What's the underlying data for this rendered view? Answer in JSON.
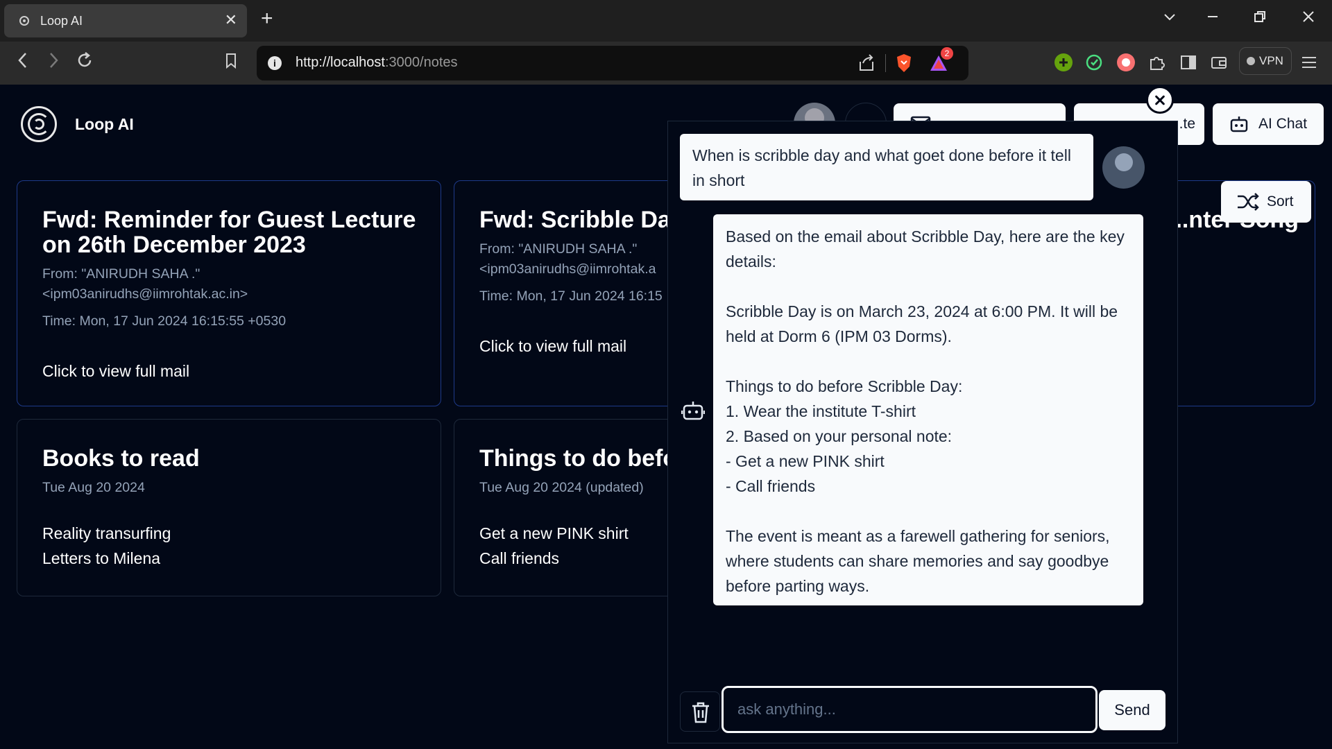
{
  "browser": {
    "tab_title": "Loop AI",
    "tab_close": "✕",
    "new_tab": "+",
    "url_host": "http://localhost",
    "url_path": ":3000/notes",
    "notification_count": "2",
    "vpn_label": "VPN"
  },
  "app": {
    "brand": "Loop AI",
    "header_buttons": [
      {
        "label": "...te"
      },
      {
        "label": "AI Chat"
      }
    ],
    "sort_label": "Sort"
  },
  "notes": [
    {
      "title": "Fwd: Reminder for Guest Lecture on 26th December 2023",
      "from_line1": "From: \"ANIRUDH SAHA .\"",
      "from_line2": "<ipm03anirudhs@iimrohtak.ac.in>",
      "time": "Time: Mon, 17 Jun 2024 16:15:55 +0530",
      "body": "Click to view full mail"
    },
    {
      "title": "Fwd: Scribble Day",
      "from_line1": "From: \"ANIRUDH SAHA .\"",
      "from_line2": "<ipm03anirudhs@iimrohtak.a",
      "time": "Time: Mon, 17 Jun 2024 16:15",
      "body": "Click to view full mail"
    },
    {
      "title": "...nter Song"
    },
    {
      "title": "Books to read",
      "date": "Tue Aug 20 2024",
      "lines": [
        "Reality transurfing",
        "Letters to Milena"
      ]
    },
    {
      "title": "Things to do befo",
      "date": "Tue Aug 20 2024 (updated)",
      "lines": [
        "Get a new PINK shirt",
        "Call friends"
      ]
    }
  ],
  "chat": {
    "user_message": "When is scribble day and what goet done before it tell in short",
    "bot_lines": [
      "Based on the email about Scribble Day, here are the key details:",
      "",
      "Scribble Day is on March 23, 2024 at 6:00 PM. It will be held at Dorm 6 (IPM 03 Dorms).",
      "",
      "Things to do before Scribble Day:",
      "1. Wear the institute T-shirt",
      "2. Based on your personal note:",
      "- Get a new PINK shirt",
      "- Call friends",
      "",
      "The event is meant as a farewell gathering for seniors, where students can share memories and say goodbye before parting ways."
    ],
    "input_placeholder": "ask anything...",
    "send_label": "Send"
  }
}
